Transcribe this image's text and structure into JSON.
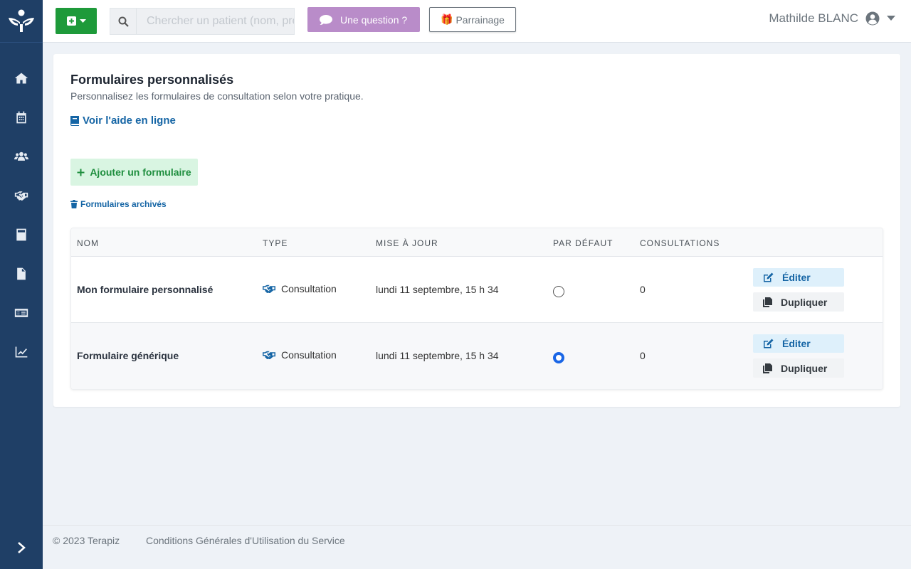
{
  "colors": {
    "sidebar": "#1f3f66",
    "primary_green": "#1e9a3a",
    "link_blue": "#1565a5",
    "question_purple": "#b98cc9",
    "radio_blue": "#1a66e6"
  },
  "sidebar": {
    "items": [
      {
        "name": "home",
        "icon": "home-icon"
      },
      {
        "name": "calendar",
        "icon": "calendar-icon"
      },
      {
        "name": "patients",
        "icon": "users-icon"
      },
      {
        "name": "consultations",
        "icon": "handshake-icon"
      },
      {
        "name": "billing",
        "icon": "calculator-icon"
      },
      {
        "name": "documents",
        "icon": "document-icon"
      },
      {
        "name": "payments",
        "icon": "money-check-icon"
      },
      {
        "name": "statistics",
        "icon": "chart-line-icon"
      }
    ]
  },
  "header": {
    "search_placeholder": "Chercher un patient (nom, prénom...)",
    "question_label": "Une question ?",
    "referral_label": "Parrainage",
    "user_name": "Mathilde BLANC"
  },
  "page": {
    "title": "Formulaires personnalisés",
    "subtitle": "Personnalisez les formulaires de consultation selon votre pratique.",
    "help_link": "Voir l'aide en ligne",
    "add_button": "Ajouter un formulaire",
    "archived_link": "Formulaires archivés"
  },
  "table": {
    "headers": {
      "name": "NOM",
      "type": "TYPE",
      "updated": "MISE À JOUR",
      "default": "PAR DÉFAUT",
      "consultations": "CONSULTATIONS"
    },
    "rows": [
      {
        "name": "Mon formulaire personnalisé",
        "type": "Consultation",
        "updated": "lundi 11 septembre, 15 h 34",
        "is_default": false,
        "consultations": "0",
        "edit_label": "Éditer",
        "duplicate_label": "Dupliquer"
      },
      {
        "name": "Formulaire générique",
        "type": "Consultation",
        "updated": "lundi 11 septembre, 15 h 34",
        "is_default": true,
        "consultations": "0",
        "edit_label": "Éditer",
        "duplicate_label": "Dupliquer"
      }
    ]
  },
  "footer": {
    "copyright": "© 2023 Terapiz",
    "terms": "Conditions Générales d'Utilisation du Service"
  }
}
